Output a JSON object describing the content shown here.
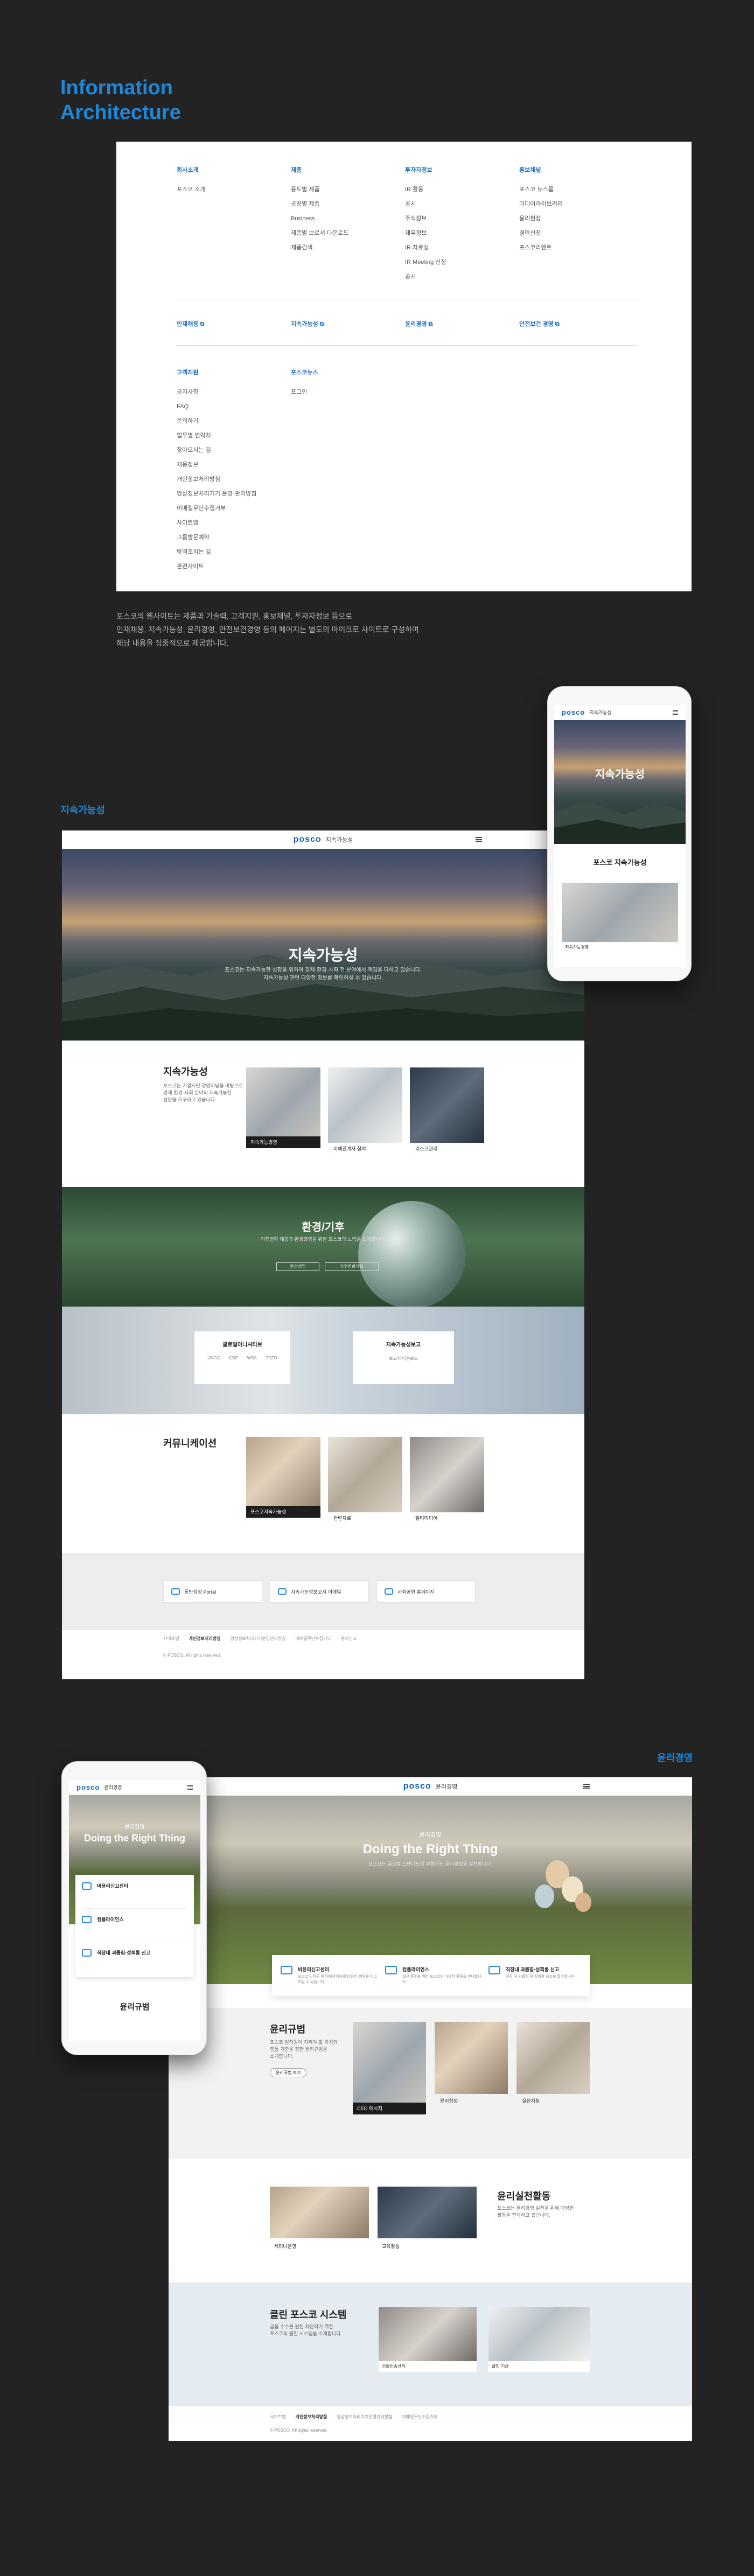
{
  "ia": {
    "title_line1": "Information",
    "title_line2": "Architecture",
    "columns": [
      {
        "title": "회사소개",
        "items": [
          "포스코 소개"
        ]
      },
      {
        "title": "제품",
        "items": [
          "용도별 제품",
          "공정별 제품",
          "Business",
          "제품별 브로셔 다운로드",
          "제품검색"
        ]
      },
      {
        "title": "투자자정보",
        "items": [
          "IR 활동",
          "공시",
          "주식정보",
          "재무정보",
          "IR 자료실",
          "IR Meeting 신청",
          "공시"
        ]
      },
      {
        "title": "홍보채널",
        "items": [
          "포스코 뉴스룸",
          "미디어라이브러리",
          "윤리헌장",
          "경력신청",
          "포스코리멘트"
        ]
      }
    ],
    "links": [
      "인재채용 ⧉",
      "지속가능성 ⧉",
      "윤리경영 ⧉",
      "안전보건 경영 ⧉"
    ],
    "columns2": [
      {
        "title": "고객지원",
        "items": [
          "공지사항",
          "FAQ",
          "문의하기",
          "업무별 연락처",
          "찾아오시는 길",
          "채용정보",
          "개인정보처리방침",
          "영상정보처리기기 운영·관리방침",
          "이메일무단수집거부",
          "사이트맵",
          "그룹방문예약",
          "방역조치는 길",
          "관련사이트"
        ]
      },
      {
        "title": "포스코뉴스",
        "items": [
          "포그인"
        ]
      }
    ],
    "description_lines": [
      "포스코의 웹사이트는 제품과 기술력, 고객지원, 홍보채널, 투자자정보 등으로",
      "인재채용, 지속가능성, 윤리경영, 안전보건경영 등의 페이지는 별도의 마이크로 사이트로 구성하여",
      "해당 내용을 집중적으로 제공합니다."
    ]
  },
  "sustain": {
    "section_label": "지속가능성",
    "logo": "posco",
    "gnb_title": "지속가능성",
    "hero_title": "지속가능성",
    "hero_sub": [
      "포스코는 지속가능한 성장을 위하여 경제·환경·사회 전 분야에서 책임을 다하고 있습니다.",
      "지속가능성 관련 다양한 정보를 확인하실 수 있습니다."
    ],
    "s1_title": "지속가능성",
    "s1_text": [
      "포스코는 기업시민 경영이념을 바탕으로",
      "경제·환경·사회 분야의 지속가능한",
      "성장을 추구하고 있습니다."
    ],
    "s1_cards": [
      "지속가능경영",
      "이해관계자 참여",
      "리스크관리"
    ],
    "env_title": "환경/기후",
    "env_sub": "기후변화 대응과 환경경영을 위한 포스코의 노력을 소개합니다.",
    "env_btns": [
      "환경경영",
      "기후변화대응"
    ],
    "report_left": {
      "title": "글로벌이니셔티브",
      "items": [
        "UNGC",
        "CDP",
        "WSA",
        "TCFD"
      ]
    },
    "report_right": {
      "title": "지속가능성보고",
      "items": [
        "보고서 다운로드"
      ]
    },
    "comm_title": "커뮤니케이션",
    "comm_cards": [
      "포스코지속가능성",
      "관련자료",
      "멀티미디어"
    ],
    "quick": [
      "동반성장 Portal",
      "지속가능성보고서 이메일",
      "사회공헌 홈페이지"
    ],
    "footer_links": [
      "사이트맵",
      "개인정보처리방침",
      "영상정보처리기기운영관리방침",
      "이메일무단수집거부",
      "윤리신고"
    ],
    "footer_copy": "© POSCO. All rights reserved."
  },
  "sustain_mobile": {
    "logo": "posco",
    "gnb_title": "지속가능성",
    "hero_title": "지속가능성",
    "s1_title": "포스코 지속가능성",
    "card_label": "지속가능경영"
  },
  "ethics": {
    "section_label": "윤리경영",
    "logo": "posco",
    "gnb_title": "윤리경영",
    "hero_kicker": "윤리경영",
    "hero_title": "Doing the Right Thing",
    "hero_sub": "포스코는 글로벌 스탠다드에 부합하는 윤리경영을 실천합니다.",
    "icons": [
      {
        "title": "비윤리신고센터",
        "text": "포스코 임직원 및 이해관계자의 비윤리 행위를 신고하실 수 있습니다."
      },
      {
        "title": "컴플라이언스",
        "text": "법규 준수를 위한 포스코의 다양한 활동을 안내합니다."
      },
      {
        "title": "직장내 괴롭힘·성희롱 신고",
        "text": "직장 내 괴롭힘 및 성희롱 신고를 접수합니다."
      }
    ],
    "rules_title": "윤리규범",
    "rules_text": [
      "포스코 임직원이 지켜야 할 가치와",
      "행동 기준을 정한 윤리규범을",
      "소개합니다."
    ],
    "rules_btn": "윤리규범 보기",
    "rules_cards": [
      "CEO 메시지",
      "윤리헌장",
      "실천지침"
    ],
    "practice_title": "윤리실천활동",
    "practice_text": [
      "포스코는 윤리경영 실천을 위해 다양한",
      "활동을 전개하고 있습니다."
    ],
    "practice_cards": [
      "세미나운영",
      "교육활동"
    ],
    "clean_title": "클린 포스코 시스템",
    "clean_text": [
      "금품 수수를 원천 차단하기 위한",
      "포스코의 클린 시스템을 소개합니다."
    ],
    "clean_cards": [
      "선물반송센터",
      "클린 기금"
    ],
    "footer_links": [
      "사이트맵",
      "개인정보처리방침",
      "영상정보처리기기운영관리방침",
      "이메일무단수집거부"
    ],
    "footer_copy": "© POSCO. All rights reserved."
  },
  "ethics_mobile": {
    "logo": "posco",
    "gnb_title": "윤리경영",
    "hero_kicker": "윤리경영",
    "hero_title": "Doing the Right Thing",
    "items": [
      "비윤리신고센터",
      "컴플라이언스",
      "직장내 괴롭힘·성희롱 신고"
    ],
    "s_title": "윤리규범"
  }
}
